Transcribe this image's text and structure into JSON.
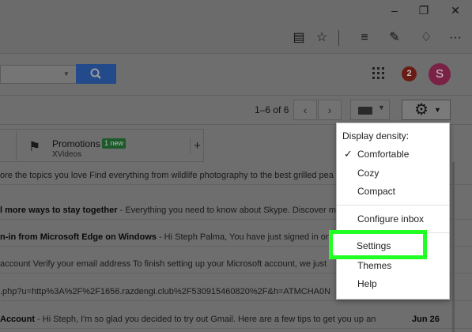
{
  "browser": {
    "window_controls": [
      "minimize-icon",
      "restore-icon",
      "close-icon"
    ],
    "toolbar_icons": [
      "reading-view-icon",
      "favorite-star-icon",
      "hub-icon",
      "web-note-icon",
      "share-icon",
      "more-icon"
    ],
    "more_label": "···"
  },
  "header": {
    "apps_icon": "apps-grid-icon",
    "notifications_count": "2",
    "avatar_letter": "S",
    "search_button_icon": "search-icon"
  },
  "toolbar": {
    "pager": "1–6 of 6",
    "prev": "‹",
    "next": "›",
    "settings_icon": "gear-icon"
  },
  "tabs": {
    "promotions_label": "Promotions",
    "promotions_badge": "1 new",
    "promotions_sub": "XVideos",
    "add_tab": "+"
  },
  "emails": [
    {
      "bold": "",
      "text": "ore the topics you love Find everything from wildlife photography to the best grilled pea",
      "date": ""
    },
    {
      "bold": "l more ways to stay together",
      "text": " - Everything you need to know about Skype. Discover m",
      "date": ""
    },
    {
      "bold": "n-in from Microsoft Edge on Windows",
      "text": " - Hi Steph Palma, You have just signed in on",
      "date": ""
    },
    {
      "bold": "",
      "text": " account Verify your email address To finish setting up your Microsoft account, we just",
      "date": ""
    },
    {
      "bold": "",
      "text": ".php?u=http%3A%2F%2F1656.razdengi.club%2F530915460820%2F&h=ATMCHA0N",
      "date": ""
    },
    {
      "bold": "Account",
      "text": " - Hi Steph, I'm so glad you decided to try out Gmail. Here are a few tips to get you up an",
      "date": "Jun 26"
    }
  ],
  "menu": {
    "density_label": "Display density:",
    "comfortable": "Comfortable",
    "cozy": "Cozy",
    "compact": "Compact",
    "configure_inbox": "Configure inbox",
    "settings": "Settings",
    "themes": "Themes",
    "help": "Help",
    "checkmark": "✓"
  },
  "colors": {
    "highlight": "#22ff22",
    "dim": "#6e6e6e"
  }
}
